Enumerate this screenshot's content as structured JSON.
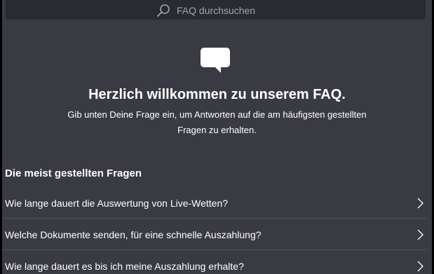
{
  "search": {
    "placeholder": "FAQ durchsuchen",
    "icon": "search-icon"
  },
  "hero": {
    "icon": "speech-bubble-icon",
    "title": "Herzlich willkommen zu unserem FAQ.",
    "line1": "Gib unten Deine Frage ein, um Antworten auf die am häufigsten gestellten",
    "line2": "Fragen zu erhalten."
  },
  "faq": {
    "section_title": "Die meist gestellten Fragen",
    "items": [
      {
        "label": "Wie lange dauert die Auswertung von Live-Wetten?"
      },
      {
        "label": "Welche Dokumente senden, für eine schnelle Auszahlung?"
      },
      {
        "label": "Wie lange dauert es bis ich meine Auszahlung erhalte?"
      }
    ]
  },
  "colors": {
    "background": "#3a3b42",
    "search_bg": "#2a2b31",
    "text": "#ffffff",
    "muted": "#a3a4ab",
    "divider": "#55565d"
  }
}
